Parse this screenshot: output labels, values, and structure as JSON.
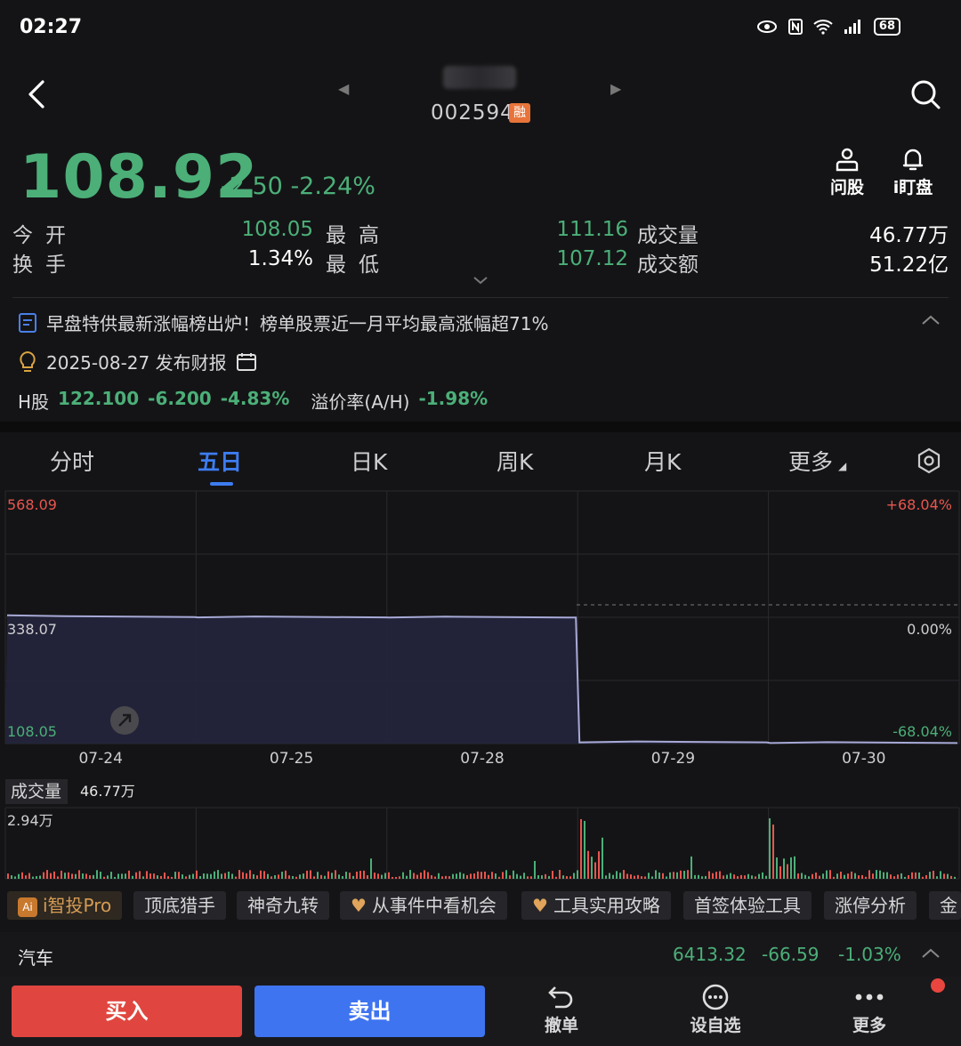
{
  "status": {
    "time": "02:27",
    "battery": "68"
  },
  "header": {
    "stock_code": "002594",
    "rong_badge": "融"
  },
  "quote": {
    "price": "108.92",
    "change": "-2.50 -2.24%",
    "open_label": "今开",
    "open": "108.05",
    "high_label": "最高",
    "high": "111.16",
    "volume_label": "成交量",
    "volume": "46.77万",
    "turnover_label": "换手",
    "turnover": "1.34%",
    "low_label": "最低",
    "low": "107.12",
    "amount_label": "成交额",
    "amount": "51.22亿"
  },
  "actions": {
    "ask": "问股",
    "watch": "i盯盘"
  },
  "news": {
    "headline": "早盘特供最新涨幅榜出炉！榜单股票近一月平均最高涨幅超71%",
    "report": "2025-08-27 发布财报"
  },
  "hshare": {
    "label": "H股",
    "price": "122.100",
    "change": "-6.200",
    "pct": "-4.83%",
    "premium_label": "溢价率(A/H)",
    "premium": "-1.98%"
  },
  "tabs": [
    "分时",
    "五日",
    "日K",
    "周K",
    "月K",
    "更多"
  ],
  "chart": {
    "y_top": "568.09",
    "y_mid": "338.07",
    "y_bottom": "108.05",
    "pct_top": "+68.04%",
    "pct_mid": "0.00%",
    "pct_bottom": "-68.04%",
    "dates": [
      "07-24",
      "07-25",
      "07-28",
      "07-29",
      "07-30"
    ],
    "volume_label": "成交量",
    "volume_value": "46.77万",
    "volume_max": "2.94万"
  },
  "chart_data": {
    "type": "line",
    "x": [
      "07-24",
      "07-25",
      "07-28",
      "07-29",
      "07-30"
    ],
    "series": [
      {
        "values": [
          338.5,
          337.8,
          337.6,
          110.2,
          109.0
        ]
      }
    ],
    "ylim": [
      108.05,
      568.09
    ],
    "grid": true
  },
  "chips": [
    "i智投Pro",
    "顶底猎手",
    "神奇九转",
    "从事件中看机会",
    "工具实用攻略",
    "首签体验工具",
    "涨停分析",
    "金"
  ],
  "sector": {
    "name": "汽车",
    "index": "6413.32",
    "change": "-66.59",
    "pct": "-1.03%"
  },
  "bottom": {
    "buy": "买入",
    "sell": "卖出",
    "cancel": "撤单",
    "add_watch": "设自选",
    "more": "更多"
  },
  "colors": {
    "up": "#e8564e",
    "down": "#4caf78",
    "accent": "#3d7cf0"
  }
}
